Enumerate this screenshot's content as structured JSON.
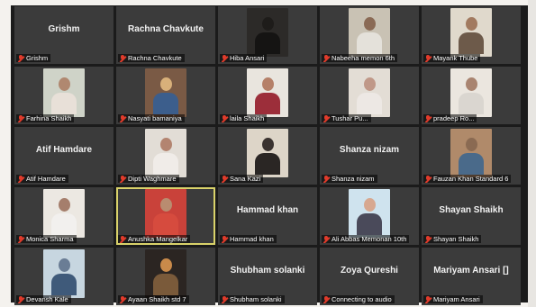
{
  "tiles": [
    {
      "big_name": "Grishm",
      "label": "Grishm",
      "type": "name"
    },
    {
      "big_name": "Rachna Chavkute",
      "label": "Rachna Chavkute",
      "type": "name"
    },
    {
      "label": "Hiba Ansari",
      "type": "video",
      "bg": "#2c2a28",
      "skin": "#1e1c1a",
      "cloth": "#151413"
    },
    {
      "label": "Nabeeha memon 6th",
      "type": "video",
      "bg": "#c9c2b4",
      "skin": "#8a6a55",
      "cloth": "#e4e1da"
    },
    {
      "label": "Mayank Thube",
      "type": "video",
      "bg": "#e0d9cc",
      "skin": "#a27a60",
      "cloth": "#6d5a4a"
    },
    {
      "label": "Farhina Shaikh",
      "type": "video",
      "bg": "#cfd3c8",
      "skin": "#b08870",
      "cloth": "#e8e0d8"
    },
    {
      "label": "Nasyati bamaniya",
      "type": "video",
      "bg": "#7a5a45",
      "skin": "#d8b07a",
      "cloth": "#3c5e8c"
    },
    {
      "label": "laila Shaikh",
      "type": "video",
      "bg": "#e9e5de",
      "skin": "#b58068",
      "cloth": "#9c2e3a"
    },
    {
      "label": "Tushar Pu...",
      "type": "video",
      "bg": "#e3ddd5",
      "skin": "#c09888",
      "cloth": "#ede8e4"
    },
    {
      "label": "pradeep Ro...",
      "type": "video",
      "bg": "#ebe6df",
      "skin": "#a98470",
      "cloth": "#dad6d0"
    },
    {
      "big_name": "Atif Hamdare",
      "label": "Atif Hamdare",
      "type": "name"
    },
    {
      "label": "Dipti Waghmare",
      "type": "video",
      "bg": "#e2ddd6",
      "skin": "#b38470",
      "cloth": "#f0ece8"
    },
    {
      "label": "Sana Kazi",
      "type": "video",
      "bg": "#ddd5c8",
      "skin": "#3a3330",
      "cloth": "#2a2624"
    },
    {
      "big_name": "Shanza nizam",
      "label": "Shanza nizam",
      "type": "name"
    },
    {
      "label": "Fauzan Khan Standard 6",
      "type": "video",
      "bg": "#b08a6a",
      "skin": "#8a6a52",
      "cloth": "#4a6a8a"
    },
    {
      "label": "Monica Sharma",
      "type": "video",
      "bg": "#ece8e2",
      "skin": "#a57e6c",
      "cloth": "#f2f0ee"
    },
    {
      "label": "Anushka Mangelkar",
      "type": "video",
      "bg": "#c9423a",
      "skin": "#b98c70",
      "cloth": "#d64b3e",
      "active": true
    },
    {
      "big_name": "Hammad khan",
      "label": "Hammad khan",
      "type": "name"
    },
    {
      "label": "Ali Abbas Memonan 10th",
      "type": "video",
      "bg": "#cfe3ee",
      "skin": "#d7a890",
      "cloth": "#4a4a5a"
    },
    {
      "big_name": "Shayan Shaikh",
      "label": "Shayan Shaikh",
      "type": "name"
    },
    {
      "label": "Devansh Kale",
      "type": "video",
      "bg": "#c7d6e0",
      "skin": "#6a7d95",
      "cloth": "#3f5a7a"
    },
    {
      "label": "Ayaan Shaikh std 7",
      "type": "video",
      "bg": "#2b2522",
      "skin": "#c98a4a",
      "cloth": "#7a5a3a"
    },
    {
      "big_name": "Shubham solanki",
      "label": "Shubham solanki",
      "type": "name"
    },
    {
      "big_name": "Zoya Qureshi",
      "label": "Connecting to audio",
      "type": "name"
    },
    {
      "big_name": "Mariyam  Ansari []",
      "label": "Mariyam Ansari",
      "type": "name"
    }
  ],
  "colors": {
    "tile": "#3b3b3b",
    "active_outline": "#d9d26a",
    "muted_mic": "#e03b2b"
  }
}
